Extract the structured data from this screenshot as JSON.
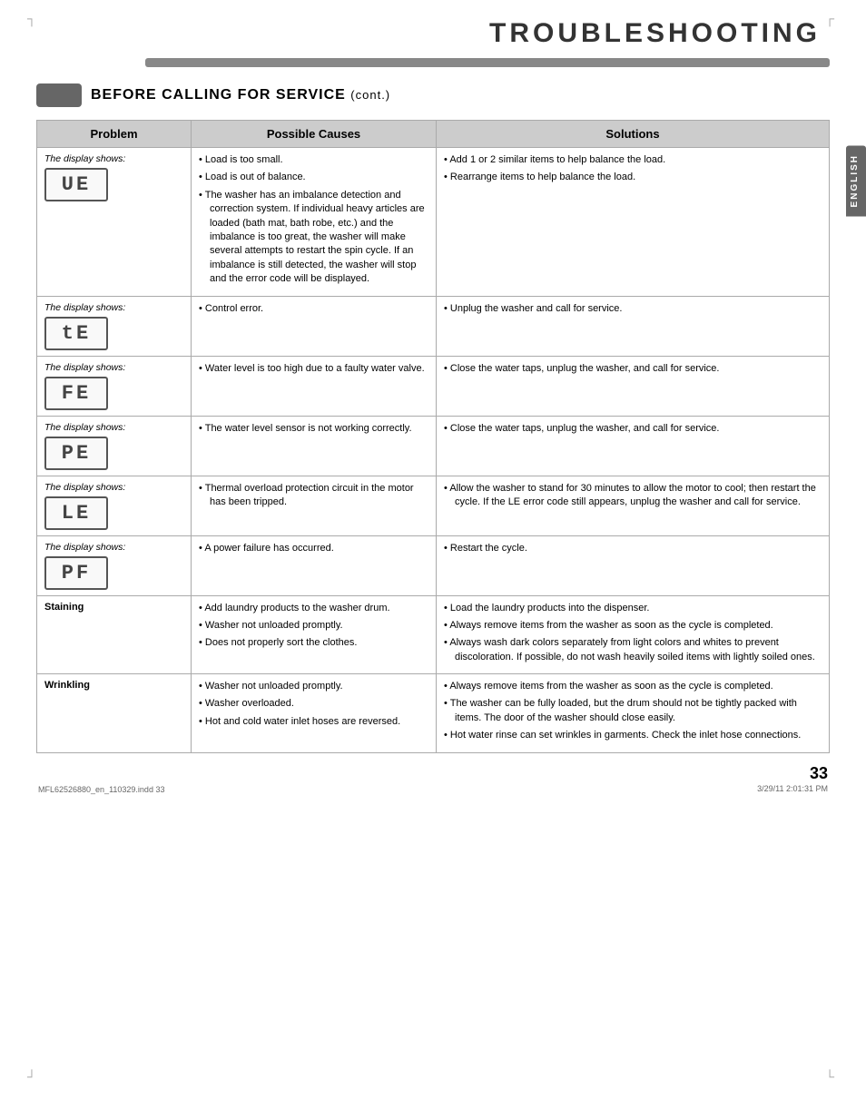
{
  "page": {
    "title": "TROUBLESHOOTING",
    "section_title": "BEFORE CALLING FOR SERVICE",
    "section_cont": "(cont.)",
    "page_number": "33",
    "footer_left": "MFL62526880_en_110329.indd   33",
    "footer_right": "3/29/11   2:01:31 PM",
    "sidebar_label": "ENGLISH"
  },
  "table": {
    "headers": [
      "Problem",
      "Possible Causes",
      "Solutions"
    ],
    "rows": [
      {
        "problem_type": "display",
        "problem_label": "The display shows:",
        "problem_code": "UE",
        "causes": [
          "Load is too small.",
          "Load is out of balance.",
          "The washer has an imbalance detection and correction system. If individual heavy articles are loaded (bath mat, bath robe, etc.) and the imbalance is too great, the washer will make several attempts to restart the spin cycle. If an imbalance is still detected, the washer will stop and the error code will be displayed."
        ],
        "solutions": [
          "Add 1 or 2 similar items to help balance the load.",
          "Rearrange items to help balance the load."
        ]
      },
      {
        "problem_type": "display",
        "problem_label": "The display shows:",
        "problem_code": "tE",
        "causes": [
          "Control error."
        ],
        "solutions": [
          "Unplug the washer and call for service."
        ]
      },
      {
        "problem_type": "display",
        "problem_label": "The display shows:",
        "problem_code": "FE",
        "causes": [
          "Water level is too high due to a faulty water valve."
        ],
        "solutions": [
          "Close the water taps, unplug the washer, and call for service."
        ]
      },
      {
        "problem_type": "display",
        "problem_label": "The display shows:",
        "problem_code": "PE",
        "causes": [
          "The water level sensor is not working correctly."
        ],
        "solutions": [
          "Close the water taps, unplug the washer, and call for service."
        ]
      },
      {
        "problem_type": "display",
        "problem_label": "The display shows:",
        "problem_code": "LE",
        "causes": [
          "Thermal overload protection circuit in the motor has been tripped."
        ],
        "solutions": [
          "Allow the washer to stand for 30 minutes to allow the motor to cool; then restart the cycle. If the LE error code still appears, unplug the washer and call for service."
        ]
      },
      {
        "problem_type": "display",
        "problem_label": "The display shows:",
        "problem_code": "PF",
        "causes": [
          "A power failure has occurred."
        ],
        "solutions": [
          "Restart the cycle."
        ]
      },
      {
        "problem_type": "text",
        "problem_label": "Staining",
        "causes": [
          "Add laundry products to the washer drum.",
          "Washer not unloaded promptly.",
          "Does not properly sort the clothes."
        ],
        "solutions": [
          "Load the laundry products into the dispenser.",
          "Always remove items from the washer as soon as the cycle is completed.",
          "Always wash dark colors separately from light colors and whites to prevent discoloration. If possible, do not wash heavily soiled items with lightly soiled ones."
        ]
      },
      {
        "problem_type": "text",
        "problem_label": "Wrinkling",
        "causes": [
          "Washer not unloaded promptly.",
          "Washer overloaded.",
          "Hot and cold water inlet hoses are reversed."
        ],
        "solutions": [
          "Always remove items from the washer as soon as the cycle is completed.",
          "The washer can be fully loaded, but the drum should not be tightly packed with items. The door of the washer should close easily.",
          "Hot water rinse can set wrinkles in garments. Check the inlet hose connections."
        ]
      }
    ]
  }
}
